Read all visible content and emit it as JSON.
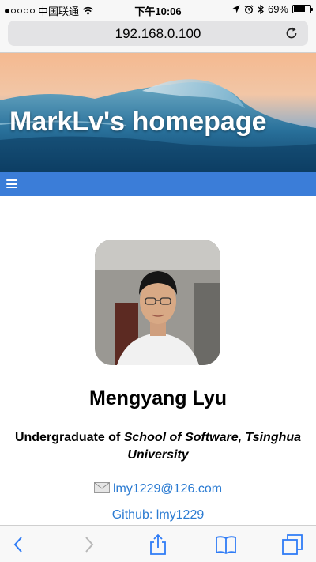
{
  "status_bar": {
    "carrier": "中国联通",
    "time": "下午10:06",
    "battery": "69%",
    "battery_level": 0.69,
    "icons": [
      "signal-dots",
      "wifi-icon",
      "location-icon",
      "alarm-icon",
      "bluetooth-icon",
      "battery-icon"
    ]
  },
  "browser": {
    "url": "192.168.0.100",
    "reload_icon": "reload-icon"
  },
  "banner": {
    "title": "MarkLv's homepage"
  },
  "navbar": {
    "menu_icon": "hamburger-menu-icon",
    "color": "#3b7dd8"
  },
  "profile": {
    "name": "Mengyang Lyu",
    "subtitle_prefix": "Undergraduate of ",
    "subtitle_emph": "School of Software, Tsinghua University",
    "email": "lmy1229@126.com",
    "github": "Github: lmy1229",
    "link_color": "#2b7bd2"
  },
  "toolbar": {
    "icons": [
      "back-icon",
      "forward-icon",
      "share-icon",
      "bookmarks-icon",
      "tabs-icon"
    ]
  }
}
